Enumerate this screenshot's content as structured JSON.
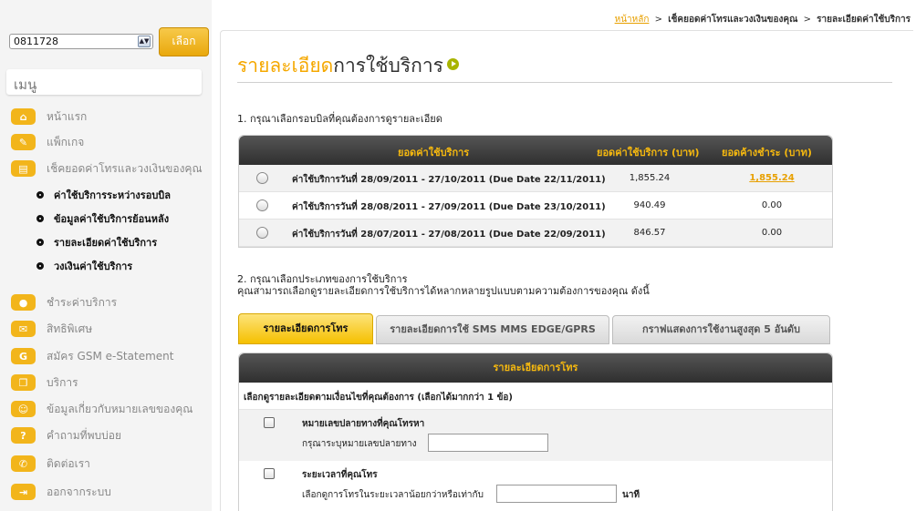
{
  "breadcrumb": {
    "home": "หน้าหลัก",
    "level2": "เช็คยอดค่าโทรและวงเงินของคุณ",
    "current": "รายละเอียดค่าใช้บริการ"
  },
  "phone_selector": {
    "value": "0811728",
    "button_label": "เลือก"
  },
  "menu": {
    "header": "เมนู",
    "items": [
      {
        "label": "หน้าแรก",
        "icon": "home-icon"
      },
      {
        "label": "แพ็กเกจ",
        "icon": "package-icon"
      },
      {
        "label": "เช็คยอดค่าโทรและวงเงินของคุณ",
        "icon": "bill-check-icon"
      },
      {
        "label": "ชำระค่าบริการ",
        "icon": "payment-icon"
      },
      {
        "label": "สิทธิพิเศษ",
        "icon": "privilege-icon"
      },
      {
        "label": "สมัคร GSM e-Statement",
        "icon": "estatement-icon"
      },
      {
        "label": "บริการ",
        "icon": "service-icon"
      },
      {
        "label": "ข้อมูลเกี่ยวกับหมายเลขของคุณ",
        "icon": "number-info-icon"
      },
      {
        "label": "คำถามที่พบบ่อย",
        "icon": "faq-icon"
      },
      {
        "label": "ติดต่อเรา",
        "icon": "contact-icon"
      },
      {
        "label": "ออกจากระบบ",
        "icon": "logout-icon"
      }
    ],
    "subitems": [
      {
        "label": "ค่าใช้บริการระหว่างรอบบิล"
      },
      {
        "label": "ข้อมูลค่าใช้บริการย้อนหลัง"
      },
      {
        "label": "รายละเอียดค่าใช้บริการ"
      },
      {
        "label": "วงเงินค่าใช้บริการ"
      }
    ]
  },
  "main": {
    "title_part1": "รายละเอียด",
    "title_part2": "การใช้บริการ",
    "step1": "1. กรุณาเลือกรอบบิลที่คุณต้องการดูรายละเอียด",
    "bill_table": {
      "headers": [
        "ยอดค่าใช้บริการ",
        "ยอดค่าใช้บริการ (บาท)",
        "ยอดค้างชำระ (บาท)"
      ],
      "rows": [
        {
          "desc": "ค่าใช้บริการวันที่ 28/09/2011 - 27/10/2011 (Due Date 22/11/2011)",
          "amount": "1,855.24",
          "outstanding": "1,855.24",
          "outstanding_link": true
        },
        {
          "desc": "ค่าใช้บริการวันที่ 28/08/2011 - 27/09/2011 (Due Date 23/10/2011)",
          "amount": "940.49",
          "outstanding": "0.00",
          "outstanding_link": false
        },
        {
          "desc": "ค่าใช้บริการวันที่ 28/07/2011 - 27/08/2011 (Due Date 22/09/2011)",
          "amount": "846.57",
          "outstanding": "0.00",
          "outstanding_link": false
        }
      ]
    },
    "step2_line1": "2. กรุณาเลือกประเภทของการใช้บริการ",
    "step2_line2": "คุณสามารถเลือกดูรายละเอียดการใช้บริการได้หลากหลายรูปแบบตามความต้องการของคุณ ดังนี้",
    "tabs": [
      {
        "label": "รายละเอียดการโทร",
        "active": true
      },
      {
        "label": "รายละเอียดการใช้ SMS MMS EDGE/GPRS",
        "active": false
      },
      {
        "label": "กราฟแสดงการใช้งานสูงสุด 5 อันดับ",
        "active": false
      }
    ],
    "detail": {
      "header": "รายละเอียดการโทร",
      "subheader": "เลือกดูรายละเอียดตามเงื่อนไขที่คุณต้องการ (เลือกได้มากกว่า 1 ข้อ)",
      "options": [
        {
          "title": "หมายเลขปลายทางที่คุณโทรหา",
          "label": "กรุณาระบุหมายเลขปลายทาง",
          "value": "",
          "unit": ""
        },
        {
          "title": "ระยะเวลาที่คุณโทร",
          "label": "เลือกดูการโทรในระยะเวลาน้อยกว่าหรือเท่ากับ",
          "value": "",
          "unit": "นาที"
        }
      ]
    }
  },
  "colors": {
    "accent": "#f5a800",
    "header_dark": "#3a3a3a",
    "header_text": "#f5b80f"
  }
}
